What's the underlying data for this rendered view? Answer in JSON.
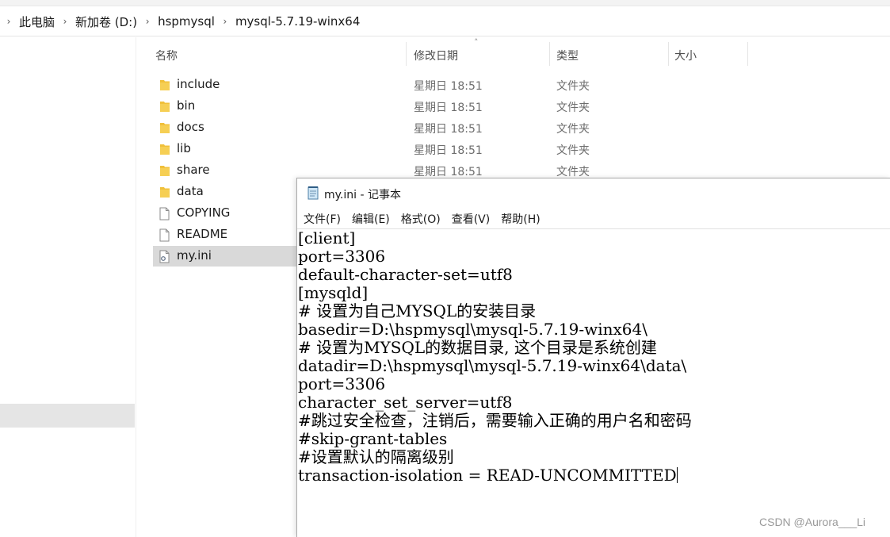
{
  "address_bar": {
    "crumbs": [
      "此电脑",
      "新加卷 (D:)",
      "hspmysql",
      "mysql-5.7.19-winx64"
    ]
  },
  "file_list": {
    "headers": {
      "name": "名称",
      "date": "修改日期",
      "type": "类型",
      "size": "大小"
    },
    "rows": [
      {
        "name": "include",
        "date": "星期日 18:51",
        "type": "文件夹",
        "icon": "folder-icon"
      },
      {
        "name": "bin",
        "date": "星期日 18:51",
        "type": "文件夹",
        "icon": "folder-icon"
      },
      {
        "name": "docs",
        "date": "星期日 18:51",
        "type": "文件夹",
        "icon": "folder-icon"
      },
      {
        "name": "lib",
        "date": "星期日 18:51",
        "type": "文件夹",
        "icon": "folder-icon"
      },
      {
        "name": "share",
        "date": "星期日 18:51",
        "type": "文件夹",
        "icon": "folder-icon"
      },
      {
        "name": "data",
        "date": "",
        "type": "",
        "icon": "folder-icon"
      },
      {
        "name": "COPYING",
        "date": "",
        "type": "",
        "icon": "file-icon"
      },
      {
        "name": "README",
        "date": "",
        "type": "",
        "icon": "file-icon"
      },
      {
        "name": "my.ini",
        "date": "",
        "type": "",
        "icon": "ini-file-icon"
      }
    ]
  },
  "notepad": {
    "title": "my.ini - 记事本",
    "menu": [
      "文件(F)",
      "编辑(E)",
      "格式(O)",
      "查看(V)",
      "帮助(H)"
    ],
    "lines": [
      "[client]",
      "port=3306",
      "default-character-set=utf8",
      "[mysqld]",
      "# 设置为自己MYSQL的安装目录",
      "basedir=D:\\hspmysql\\mysql-5.7.19-winx64\\",
      "# 设置为MYSQL的数据目录, 这个目录是系统创建",
      "datadir=D:\\hspmysql\\mysql-5.7.19-winx64\\data\\",
      "port=3306",
      "character_set_server=utf8",
      "#跳过安全检查，注销后，需要输入正确的用户名和密码",
      "#skip-grant-tables",
      "#设置默认的隔离级别",
      "transaction-isolation = READ-UNCOMMITTED"
    ]
  },
  "watermark": "CSDN @Aurora___Li",
  "colors": {
    "folder": "#f0c03a",
    "selected_row": "#d9d9d9"
  }
}
